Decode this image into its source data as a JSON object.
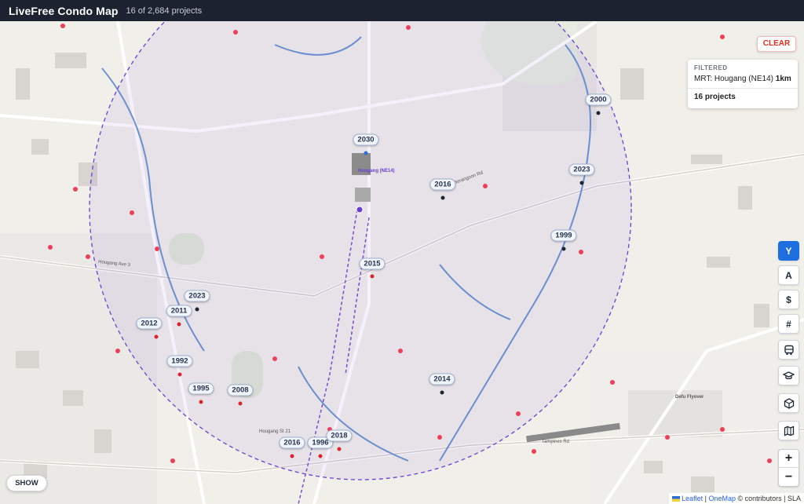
{
  "header": {
    "title": "LiveFree Condo Map",
    "count": "16 of 2,684 projects"
  },
  "filter_panel": {
    "heading": "FILTERED",
    "mrt_prefix": "MRT: Hougang (NE14)",
    "radius": "1km",
    "projects": "16 projects"
  },
  "clear_label": "CLEAR",
  "show_label": "SHOW",
  "side_buttons": [
    {
      "label": "Y",
      "icon": "year-letter",
      "active": true
    },
    {
      "label": "A",
      "icon": "area-letter",
      "active": false
    },
    {
      "label": "$",
      "icon": "price-dollar",
      "active": false
    },
    {
      "label": "#",
      "icon": "hash",
      "active": false
    },
    {
      "label": "",
      "icon": "bus-icon",
      "active": false
    },
    {
      "label": "",
      "icon": "graduation-cap-icon",
      "active": false
    },
    {
      "label": "",
      "icon": "cube-icon",
      "active": false
    },
    {
      "label": "",
      "icon": "map-icon",
      "active": false
    }
  ],
  "zoom": {
    "in": "+",
    "out": "−"
  },
  "pins": [
    {
      "label": "2030",
      "status": "blue"
    },
    {
      "label": "2000",
      "status": "black"
    },
    {
      "label": "2023",
      "status": "black"
    },
    {
      "label": "2016",
      "status": "black"
    },
    {
      "label": "1999",
      "status": "black"
    },
    {
      "label": "2015",
      "status": "red"
    },
    {
      "label": "2023",
      "status": "black"
    },
    {
      "label": "2011",
      "status": "red"
    },
    {
      "label": "2012",
      "status": "red"
    },
    {
      "label": "1992",
      "status": "red"
    },
    {
      "label": "1995",
      "status": "red"
    },
    {
      "label": "2008",
      "status": "red"
    },
    {
      "label": "2014",
      "status": "black"
    },
    {
      "label": "2016",
      "status": "red"
    },
    {
      "label": "1996",
      "status": "red"
    },
    {
      "label": "2018",
      "status": "red"
    }
  ],
  "map_labels": {
    "hougang_station": "Hougang (NE14)",
    "road_1": "Hougang Ave 3",
    "road_2": "Upper Serangoon Rd",
    "road_3": "Tampines Rd",
    "road_4": "Defu Flyover",
    "road_5": "Hougang St 21"
  },
  "attribution": {
    "leaflet": "Leaflet",
    "onemap": "OneMap",
    "rest": "© contributors | SLA"
  },
  "colors": {
    "topbar": "#1c2230",
    "accent_blue": "#1d6fe0",
    "clear_red": "#e0301e",
    "circle": "#6a3fd6"
  }
}
